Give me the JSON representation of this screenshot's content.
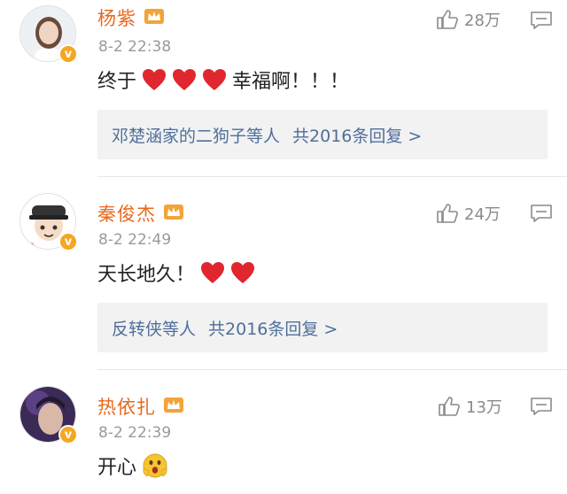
{
  "comments": [
    {
      "username": "杨紫",
      "time": "8-2 22:38",
      "text": "终于",
      "text_after": "幸福啊！！！",
      "hearts": 3,
      "likes": "28万",
      "reply_names": "邓楚涵家的二狗子等人",
      "reply_total": "共2016条回复 >"
    },
    {
      "username": "秦俊杰",
      "time": "8-2 22:49",
      "text": "天长地久！",
      "hearts": 2,
      "likes": "24万",
      "reply_names": "反转侠等人",
      "reply_total": "共2016条回复 >"
    },
    {
      "username": "热依扎",
      "time": "8-2 22:39",
      "text": "开心",
      "likes": "13万"
    }
  ],
  "verified_mark": "v",
  "icons": {
    "like": "thumbs-up-icon",
    "comment": "comment-icon",
    "crown": "crown-badge-icon",
    "heart": "heart-emoji-icon",
    "wow": "surprised-emoji-icon"
  },
  "colors": {
    "username": "#e8691f",
    "time": "#9a9a9a",
    "reply_link": "#4f6f9a",
    "reply_bg": "#f2f2f2",
    "heart": "#e0262f"
  }
}
